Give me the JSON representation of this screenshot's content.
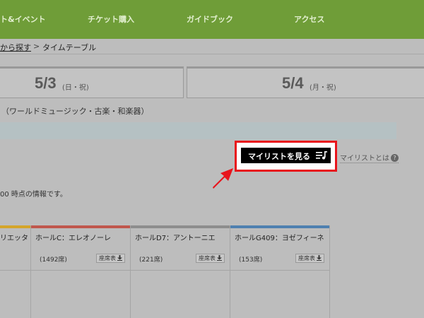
{
  "nav": {
    "items": [
      "ト&イベント",
      "チケット購入",
      "ガイドブック",
      "アクセス"
    ],
    "colors": {
      "background": "#6f9d38",
      "text": "#e2efcf"
    }
  },
  "breadcrumb": {
    "link": "から探す",
    "separator": ">",
    "current": "タイムテーブル"
  },
  "dates": [
    {
      "date": "5/3",
      "day": "(日・祝)"
    },
    {
      "date": "5/4",
      "day": "(月・祝)"
    }
  ],
  "category": "（ワールドミュージック・古楽・和楽器）",
  "mylist": {
    "button_label": "マイリストを見る",
    "icon": "playlist-icon",
    "help_label": "マイリストとは",
    "help_icon": "question-icon",
    "highlight_color": "#e8141c"
  },
  "note": "00 時点の情報です。",
  "halls": [
    {
      "name": "リエッタ",
      "seats": "",
      "seat_chart": "",
      "bar_color": "#d4a52a"
    },
    {
      "name": "ホールC：エレオノーレ",
      "seats": "(1492席)",
      "seat_chart": "座席表",
      "bar_color": "#c0574d"
    },
    {
      "name": "ホールD7：アントーニエ",
      "seats": "(221席)",
      "seat_chart": "座席表",
      "bar_color": "#8d8d8d"
    },
    {
      "name": "ホールG409：ヨゼフィーネ",
      "seats": "(153席)",
      "seat_chart": "座席表",
      "bar_color": "#4f80b0"
    }
  ]
}
